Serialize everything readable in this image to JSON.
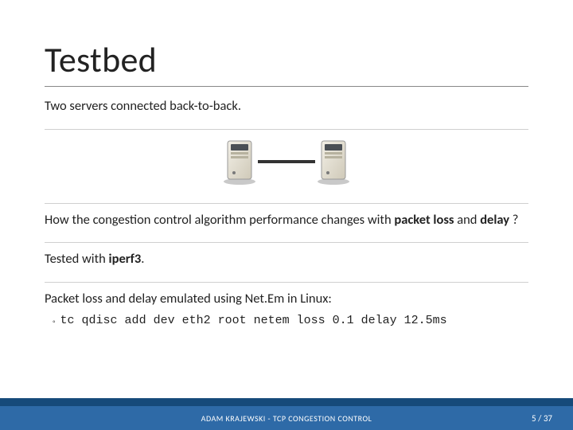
{
  "title": "Testbed",
  "p1": "Two servers connected back-to-back.",
  "p2a": "How the congestion control algorithm performance changes with ",
  "p2b_bold": "packet loss",
  "p2c": " and ",
  "p2d_bold": "delay",
  "p2e": " ?",
  "p3a": "Tested with ",
  "p3b_bold": "iperf3",
  "p3c": ".",
  "p4": "Packet loss and delay emulated using Net.Em in Linux:",
  "cmd": "tc qdisc add dev eth2 root netem loss 0.1 delay 12.5ms",
  "footer": {
    "center": "ADAM KRAJEWSKI - TCP CONGESTION CONTROL",
    "page": "5 / 37"
  },
  "diagram": {
    "left": "server-icon",
    "right": "server-icon",
    "connection": "ethernet-link"
  }
}
